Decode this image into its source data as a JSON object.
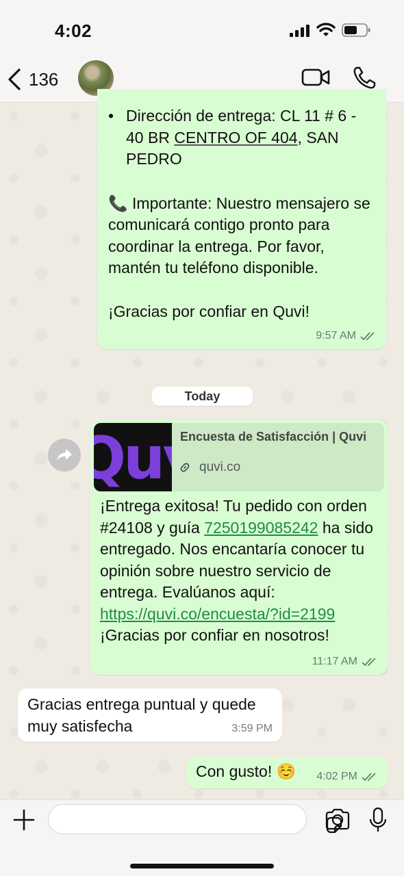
{
  "status_bar": {
    "time": "4:02"
  },
  "header": {
    "back_count": "136"
  },
  "messages": {
    "delivery_bullet_label": "Dirección de entrega: CL 11 # 6 - 40 BR ",
    "delivery_bullet_underlined": "CENTRO OF 404",
    "delivery_bullet_rest": ", SAN PEDRO",
    "important_emoji": "📞",
    "important_text": " Importante: Nuestro mensajero se comunicará contigo pronto para coordinar la entrega. Por favor, mantén tu teléfono disponible.",
    "thanks_text": "¡Gracias por confiar en Quvi!",
    "first_time": "9:57 AM"
  },
  "date_separator": "Today",
  "survey": {
    "preview_title": "Encuesta de Satisfacción | Quvi",
    "preview_domain": "quvi.co",
    "thumb_text": "Quv",
    "text_part1": "¡Entrega exitosa! Tu pedido con orden #24108 y guía ",
    "tracking_number": "7250199085242",
    "text_part2": " ha sido entregado. Nos encantaría conocer tu opinión sobre nuestro servicio de entrega. Evalúanos aquí: ",
    "survey_link": "https://quvi.co/encuesta/?id=2199",
    "text_part3": " ¡Gracias por confiar en nosotros!",
    "time": "11:17 AM"
  },
  "reply": {
    "text": "Gracias entrega puntual y quede muy satisfecha",
    "time": "3:59 PM"
  },
  "last": {
    "text": "Con gusto! ☺️",
    "time": "4:02 PM"
  },
  "colors": {
    "outgoing_bubble": "#d9fdd3",
    "incoming_bubble": "#ffffff",
    "link": "#1f8a4c",
    "thumb_brand": "#7c3fd9"
  }
}
